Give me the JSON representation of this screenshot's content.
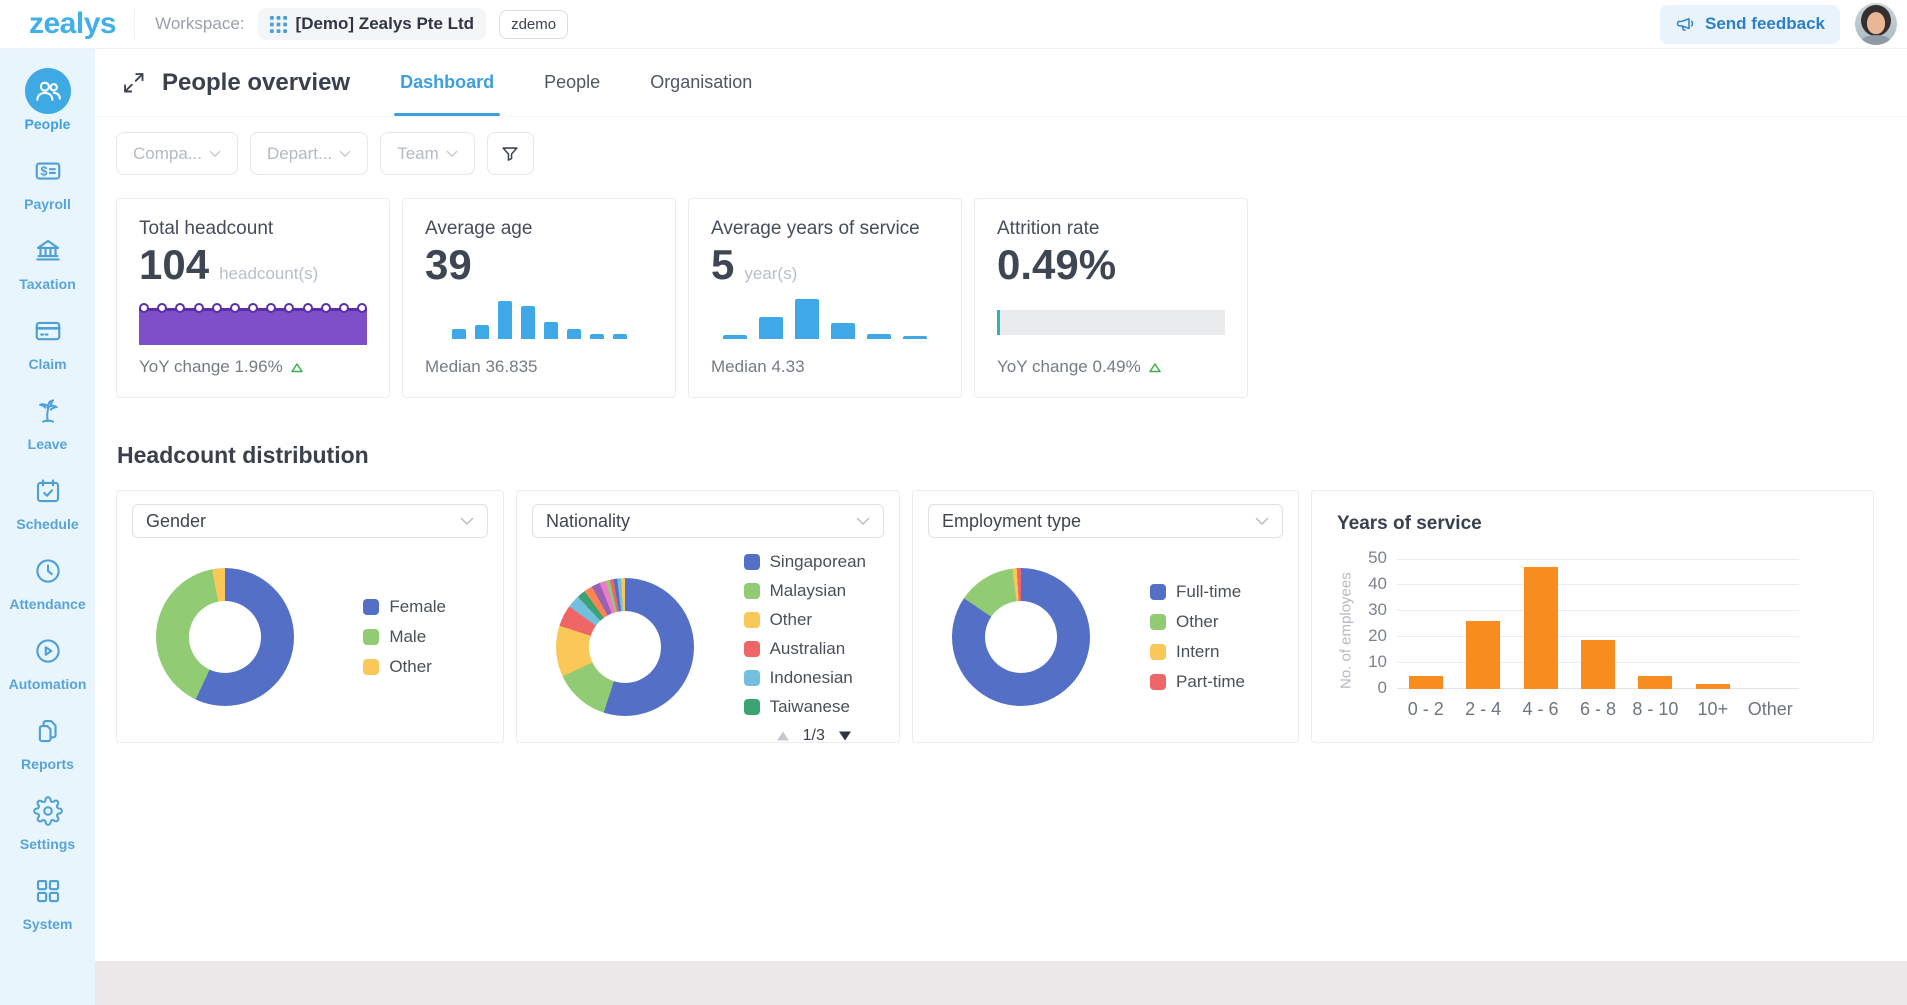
{
  "header": {
    "logo_text": "zealys",
    "workspace_label": "Workspace:",
    "workspace_name": "[Demo] Zealys Pte Ltd",
    "workspace_code": "zdemo",
    "send_feedback_label": "Send feedback"
  },
  "sidebar": {
    "items": [
      {
        "label": "People",
        "icon": "people-icon",
        "active": true
      },
      {
        "label": "Payroll",
        "icon": "payroll-icon",
        "active": false
      },
      {
        "label": "Taxation",
        "icon": "taxation-icon",
        "active": false
      },
      {
        "label": "Claim",
        "icon": "claim-icon",
        "active": false
      },
      {
        "label": "Leave",
        "icon": "leave-icon",
        "active": false
      },
      {
        "label": "Schedule",
        "icon": "schedule-icon",
        "active": false
      },
      {
        "label": "Attendance",
        "icon": "attendance-icon",
        "active": false
      },
      {
        "label": "Automation",
        "icon": "automation-icon",
        "active": false
      },
      {
        "label": "Reports",
        "icon": "reports-icon",
        "active": false
      },
      {
        "label": "Settings",
        "icon": "settings-icon",
        "active": false
      },
      {
        "label": "System",
        "icon": "system-icon",
        "active": false
      }
    ]
  },
  "page": {
    "title": "People overview",
    "tabs": [
      {
        "label": "Dashboard",
        "active": true
      },
      {
        "label": "People",
        "active": false
      },
      {
        "label": "Organisation",
        "active": false
      }
    ]
  },
  "filters": {
    "company_label": "Compa...",
    "department_label": "Depart...",
    "team_label": "Team"
  },
  "kpis": [
    {
      "title": "Total headcount",
      "value": "104",
      "unit": "headcount(s)",
      "footer": "YoY change 1.96%",
      "trend": "up",
      "chart": {
        "type": "area",
        "color": "#7d4fc9",
        "line_color": "#5b2da6",
        "marker_count": 13
      }
    },
    {
      "title": "Average age",
      "value": "39",
      "unit": "",
      "footer": "Median 36.835",
      "chart": {
        "type": "bar",
        "color": "#3fa9e8",
        "values": [
          26,
          37,
          100,
          87,
          45,
          26,
          13,
          13
        ]
      }
    },
    {
      "title": "Average years of service",
      "value": "5",
      "unit": "year(s)",
      "footer": "Median 4.33",
      "chart": {
        "type": "bar",
        "color": "#3fa9e8",
        "values": [
          10,
          55,
          100,
          40,
          12,
          5
        ]
      }
    },
    {
      "title": "Attrition rate",
      "value": "0.49%",
      "unit": "",
      "footer": "YoY change 0.49%",
      "trend": "up",
      "chart": {
        "type": "progress",
        "track_color": "#e9ebed",
        "accent_color": "#2ab3c0",
        "percent": 1
      }
    }
  ],
  "distribution": {
    "section_title": "Headcount distribution",
    "cards": [
      {
        "selector": "Gender",
        "type": "donut",
        "series": [
          {
            "name": "Female",
            "value": 57,
            "color": "#5470c6"
          },
          {
            "name": "Male",
            "value": 40,
            "color": "#91cc75"
          },
          {
            "name": "Other",
            "value": 3,
            "color": "#fac858"
          }
        ]
      },
      {
        "selector": "Nationality",
        "type": "donut",
        "series": [
          {
            "name": "Singaporean",
            "value": 55,
            "color": "#5470c6"
          },
          {
            "name": "Malaysian",
            "value": 13,
            "color": "#91cc75"
          },
          {
            "name": "Other",
            "value": 12,
            "color": "#fac858"
          },
          {
            "name": "Australian",
            "value": 5,
            "color": "#ee6666"
          },
          {
            "name": "Indonesian",
            "value": 3,
            "color": "#73c0de"
          },
          {
            "name": "Taiwanese",
            "value": 2,
            "color": "#3ba272"
          }
        ],
        "extra_slices": [
          {
            "value": 2,
            "color": "#fc8452"
          },
          {
            "value": 2,
            "color": "#9a60b4"
          },
          {
            "value": 1.5,
            "color": "#ea7ccc"
          },
          {
            "value": 0.9,
            "color": "#91cc75"
          },
          {
            "value": 0.9,
            "color": "#ee6666"
          },
          {
            "value": 0.9,
            "color": "#5470c6"
          },
          {
            "value": 0.9,
            "color": "#73c0de"
          },
          {
            "value": 0.9,
            "color": "#fac858"
          }
        ],
        "pagination": {
          "current": "1/3"
        }
      },
      {
        "selector": "Employment type",
        "type": "donut",
        "series": [
          {
            "name": "Full-time",
            "value": 84.5,
            "color": "#5470c6"
          },
          {
            "name": "Other",
            "value": 13.5,
            "color": "#91cc75"
          },
          {
            "name": "Intern",
            "value": 1,
            "color": "#fac858"
          },
          {
            "name": "Part-time",
            "value": 1,
            "color": "#ee6666"
          }
        ]
      },
      {
        "title": "Years of service",
        "type": "bar",
        "color": "#f98c1e",
        "categories": [
          "0 - 2",
          "2 - 4",
          "4 - 6",
          "6 - 8",
          "8 - 10",
          "10+",
          "Other"
        ],
        "values": [
          5,
          26,
          47,
          19,
          5,
          2,
          0
        ],
        "ylabel": "No. of employees",
        "yticks": [
          0,
          10,
          20,
          30,
          40,
          50
        ],
        "ymax": 50
      }
    ]
  }
}
